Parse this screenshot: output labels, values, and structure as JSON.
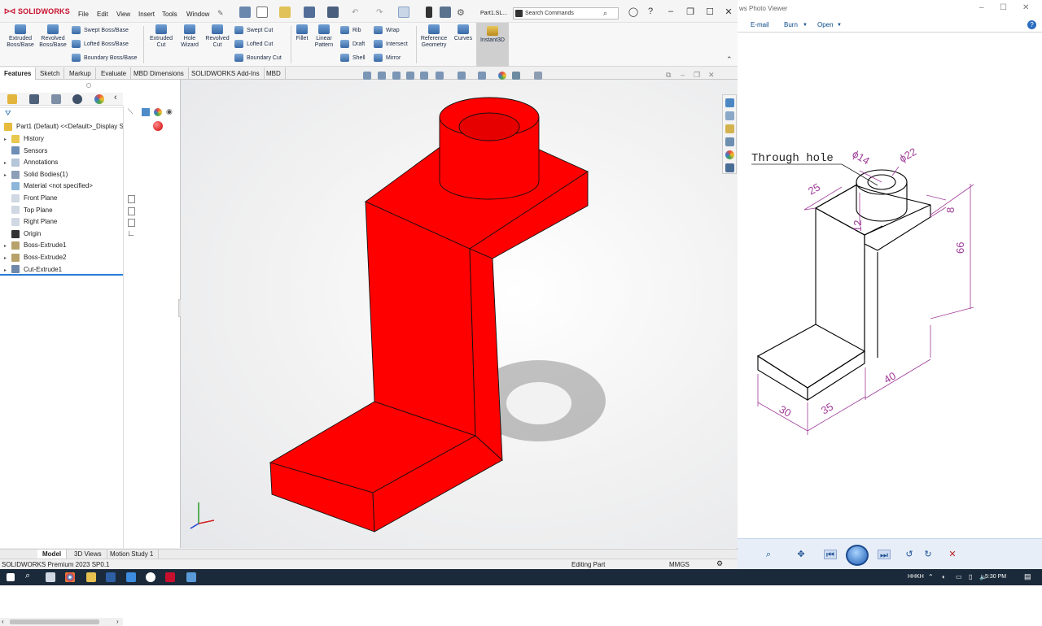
{
  "solidworks": {
    "logo": "SOLIDWORKS",
    "menu": [
      "File",
      "Edit",
      "View",
      "Insert",
      "Tools",
      "Window"
    ],
    "doc_title": "Part1.SL...",
    "search_placeholder": "Search Commands",
    "ribbon": {
      "extruded_boss": "Extruded Boss/Base",
      "revolved_boss": "Revolved Boss/Base",
      "swept_boss": "Swept Boss/Base",
      "lofted_boss": "Lofted Boss/Base",
      "boundary_boss": "Boundary Boss/Base",
      "extruded_cut": "Extruded Cut",
      "hole_wizard": "Hole Wizard",
      "revolved_cut": "Revolved Cut",
      "swept_cut": "Swept Cut",
      "lofted_cut": "Lofted Cut",
      "boundary_cut": "Boundary Cut",
      "fillet": "Fillet",
      "linear_pattern": "Linear Pattern",
      "rib": "Rib",
      "draft": "Draft",
      "shell": "Shell",
      "wrap": "Wrap",
      "intersect": "Intersect",
      "mirror": "Mirror",
      "reference_geometry": "Reference Geometry",
      "curves": "Curves",
      "instant3d": "Instant3D"
    },
    "tabs": [
      "Features",
      "Sketch",
      "Markup",
      "Evaluate",
      "MBD Dimensions",
      "SOLIDWORKS Add-Ins",
      "MBD"
    ],
    "active_tab": "Features",
    "tree": {
      "root": "Part1 (Default) <<Default>_Display Sta",
      "items": [
        {
          "label": "History",
          "expandable": true
        },
        {
          "label": "Sensors",
          "expandable": false
        },
        {
          "label": "Annotations",
          "expandable": true
        },
        {
          "label": "Solid Bodies(1)",
          "expandable": true
        },
        {
          "label": "Material <not specified>",
          "expandable": false
        },
        {
          "label": "Front Plane",
          "expandable": false
        },
        {
          "label": "Top Plane",
          "expandable": false
        },
        {
          "label": "Right Plane",
          "expandable": false
        },
        {
          "label": "Origin",
          "expandable": false
        },
        {
          "label": "Boss-Extrude1",
          "expandable": true
        },
        {
          "label": "Boss-Extrude2",
          "expandable": true
        },
        {
          "label": "Cut-Extrude1",
          "expandable": true
        }
      ]
    },
    "model_tabs": [
      "Model",
      "3D Views",
      "Motion Study 1"
    ],
    "active_model_tab": "Model",
    "status": {
      "version": "SOLIDWORKS Premium 2023 SP0.1",
      "mode": "Editing Part",
      "units": "MMGS"
    },
    "part_color": "#ff0000"
  },
  "photo_viewer": {
    "title": "ws Photo Viewer",
    "menu": [
      "E-mail",
      "Burn",
      "Open"
    ],
    "drawing": {
      "annotation": "Through hole",
      "dims": [
        "ϕ14",
        "ϕ22",
        "25",
        "12",
        "8",
        "66",
        "40",
        "30",
        "35"
      ]
    }
  },
  "taskbar": {
    "lang": "HHKH",
    "time": "5:30 PM"
  }
}
